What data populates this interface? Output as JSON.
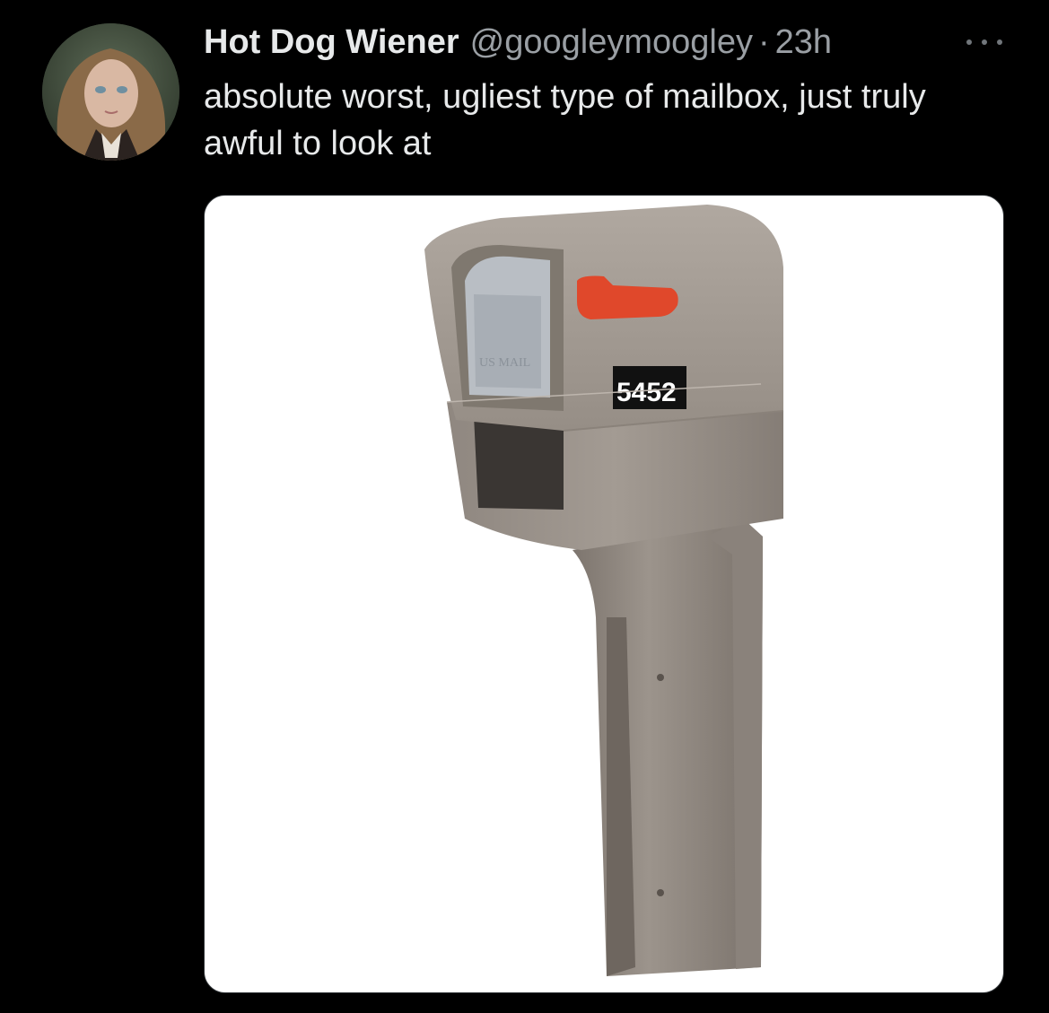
{
  "tweet": {
    "display_name": "Hot Dog Wiener",
    "handle": "@googleymoogley",
    "separator": "·",
    "timestamp": "23h",
    "text": "absolute worst, ugliest type of mailbox, just truly awful to look at",
    "more_icon": "more-horizontal-icon"
  },
  "media": {
    "house_number": "5452",
    "mailbox_label": "US MAIL",
    "colors": {
      "mailbox": "#9a928a",
      "flag": "#e0482b",
      "background": "#ffffff"
    }
  }
}
